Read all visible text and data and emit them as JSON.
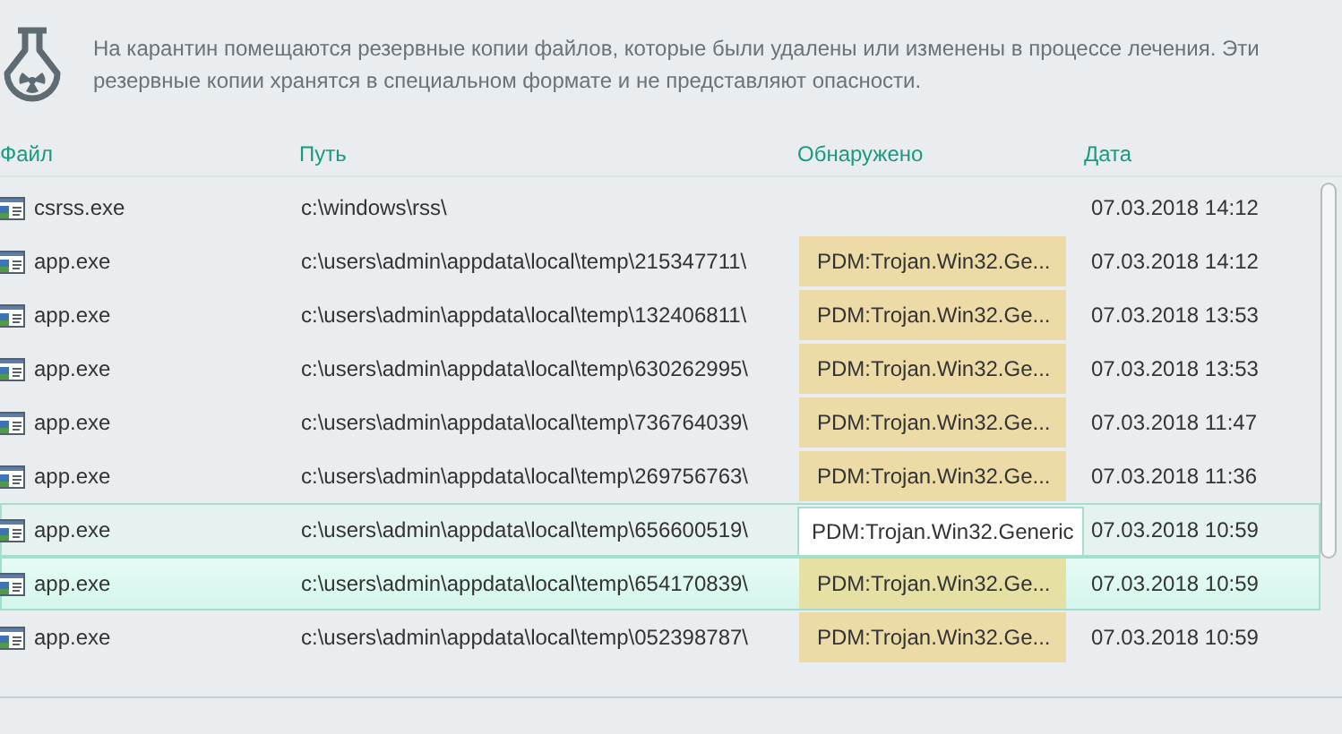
{
  "description": "На карантин помещаются резервные копии файлов, которые были удалены или изменены в процессе лечения. Эти резервные копии хранятся в специальном формате и не представляют опасности.",
  "table": {
    "columns": [
      "Файл",
      "Путь",
      "Обнаружено",
      "Дата"
    ],
    "rows": [
      {
        "file": "csrss.exe",
        "path": "c:\\windows\\rss\\",
        "date": "07.03.2018 14:12",
        "selected": false,
        "hovered": false
      },
      {
        "file": "app.exe",
        "path": "c:\\users\\admin\\appdata\\local\\temp\\215347711\\",
        "detected": "PDM:Trojan.Win32.Ge...",
        "date": "07.03.2018 14:12",
        "selected": false,
        "hovered": false
      },
      {
        "file": "app.exe",
        "path": "c:\\users\\admin\\appdata\\local\\temp\\132406811\\",
        "detected": "PDM:Trojan.Win32.Ge...",
        "date": "07.03.2018 13:53",
        "selected": false,
        "hovered": false
      },
      {
        "file": "app.exe",
        "path": "c:\\users\\admin\\appdata\\local\\temp\\630262995\\",
        "detected": "PDM:Trojan.Win32.Ge...",
        "date": "07.03.2018 13:53",
        "selected": false,
        "hovered": false
      },
      {
        "file": "app.exe",
        "path": "c:\\users\\admin\\appdata\\local\\temp\\736764039\\",
        "detected": "PDM:Trojan.Win32.Ge...",
        "date": "07.03.2018 11:47",
        "selected": false,
        "hovered": false
      },
      {
        "file": "app.exe",
        "path": "c:\\users\\admin\\appdata\\local\\temp\\269756763\\",
        "detected": "PDM:Trojan.Win32.Ge...",
        "date": "07.03.2018 11:36",
        "selected": false,
        "hovered": false
      },
      {
        "file": "app.exe",
        "path": "c:\\users\\admin\\appdata\\local\\temp\\656600519\\",
        "tooltip": "PDM:Trojan.Win32.Generic",
        "date": "07.03.2018 10:59",
        "selected": false,
        "hovered": true
      },
      {
        "file": "app.exe",
        "path": "c:\\users\\admin\\appdata\\local\\temp\\654170839\\",
        "detected": "PDM:Trojan.Win32.Ge...",
        "date": "07.03.2018 10:59",
        "selected": true,
        "hovered": false
      },
      {
        "file": "app.exe",
        "path": "c:\\users\\admin\\appdata\\local\\temp\\052398787\\",
        "detected": "PDM:Trojan.Win32.Ge...",
        "date": "07.03.2018 10:59",
        "selected": false,
        "hovered": false
      }
    ]
  }
}
